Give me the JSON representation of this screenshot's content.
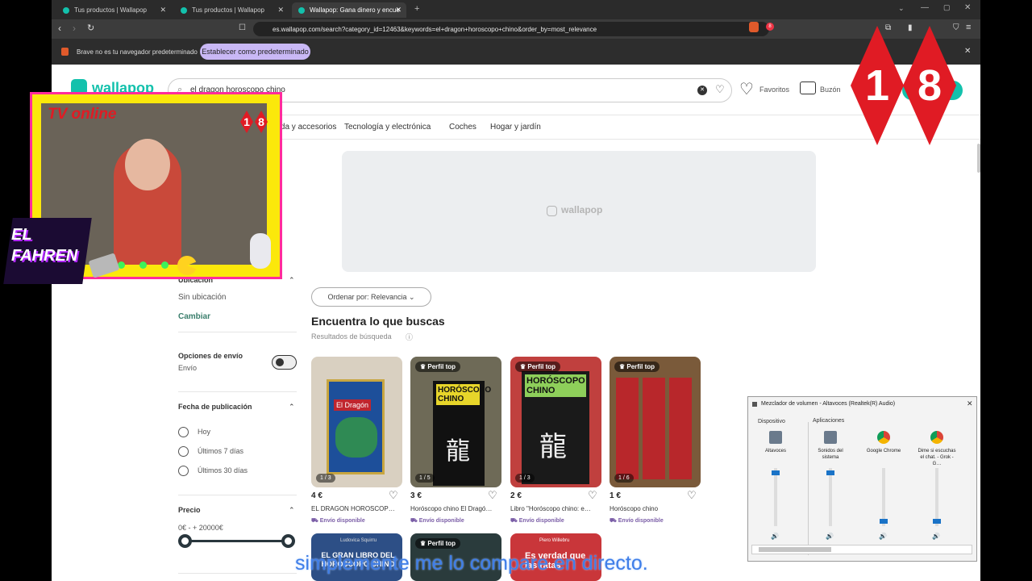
{
  "browser": {
    "tabs": [
      "Tus productos | Wallapop",
      "Tus productos | Wallapop",
      "Wallapop: Gana dinero y encue"
    ],
    "url": "es.wallapop.com/search?category_id=12463&keywords=el+dragon+horoscopo+chino&order_by=most_relevance",
    "infobar_text": "Brave no es tu navegador predeterminado",
    "infobar_button": "Establecer como predeterminado",
    "ext_badge": "8"
  },
  "header": {
    "logo": "wallapop",
    "search_value": "el dragon horoscopo chino",
    "favoritos": "Favoritos",
    "buzon": "Buzón"
  },
  "categories": [
    "Moda y accesorios",
    "Tecnología y electrónica",
    "Coches",
    "Hogar y jardín"
  ],
  "banner_logo": "wallapop",
  "filters": {
    "ubicacion_title": "Ubicación",
    "ubicacion_value": "Sin ubicación",
    "cambiar": "Cambiar",
    "envio_title": "Opciones de envío",
    "envio_value": "Envío",
    "fecha_title": "Fecha de publicación",
    "fecha_options": [
      "Hoy",
      "Últimos 7 días",
      "Últimos 30 días"
    ],
    "precio_title": "Precio",
    "precio_range": "0€ - + 20000€"
  },
  "results": {
    "sort_label": "Ordenar por: Relevancia",
    "heading": "Encuentra lo que buscas",
    "subheading": "Resultados de búsqueda",
    "products": [
      {
        "price": "4 €",
        "title": "EL DRAGON HOROSCOP…",
        "shipping": "Envío disponible",
        "count": "1 / 3",
        "badge": "",
        "cover": "El Dragón"
      },
      {
        "price": "3 €",
        "title": "Horóscopo chino El Dragó…",
        "shipping": "Envío disponible",
        "count": "1 / 5",
        "badge": "Perfil top",
        "cover": "HORÓSCOPO CHINO"
      },
      {
        "price": "2 €",
        "title": "Libro \"Horóscopo chino: e…",
        "shipping": "Envío disponible",
        "count": "1 / 3",
        "badge": "Perfil top",
        "cover": "HORÓSCOPO CHINO"
      },
      {
        "price": "1 €",
        "title": "Horóscopo chino",
        "shipping": "Envío disponible",
        "count": "1 / 6",
        "badge": "Perfil top",
        "cover": ""
      }
    ],
    "second_row": [
      {
        "badge": "",
        "cover_top": "Ludovica Squirru",
        "cover": "EL GRAN LIBRO DEL HORÓSCOPO CHINO"
      },
      {
        "badge": "Perfil top",
        "cover_top": "",
        "cover": ""
      },
      {
        "badge": "",
        "cover_top": "Piero Willebru",
        "cover": "Es verdad que las ratas"
      }
    ]
  },
  "overlay": {
    "tv_text": "TV online",
    "badge_digits": [
      "1",
      "8"
    ],
    "fahren": "EL FAHREN",
    "big_digits": [
      "1",
      "8"
    ],
    "subtitle": "simplemente me lo compare en directo."
  },
  "mixer": {
    "title": "Mezclador de volumen - Altavoces (Realtek(R) Audio)",
    "dispositivo": "Dispositivo",
    "aplicaciones": "Aplicaciones",
    "channels": [
      {
        "name": "Altavoces",
        "icon": "speaker-device-icon",
        "level": 0.95
      },
      {
        "name": "Sonidos del sistema",
        "icon": "system-sounds-icon",
        "level": 0.95
      },
      {
        "name": "Google Chrome",
        "icon": "chrome-icon",
        "level": 0.05
      },
      {
        "name": "Dime si escuchas el chat. - Grok - G…",
        "icon": "chrome-icon",
        "level": 0.05
      }
    ]
  },
  "colors": {
    "brand": "#13c1ac",
    "link": "#3a7e6c",
    "shipping": "#7b5ea7",
    "mixer_thumb": "#1a73c7"
  }
}
